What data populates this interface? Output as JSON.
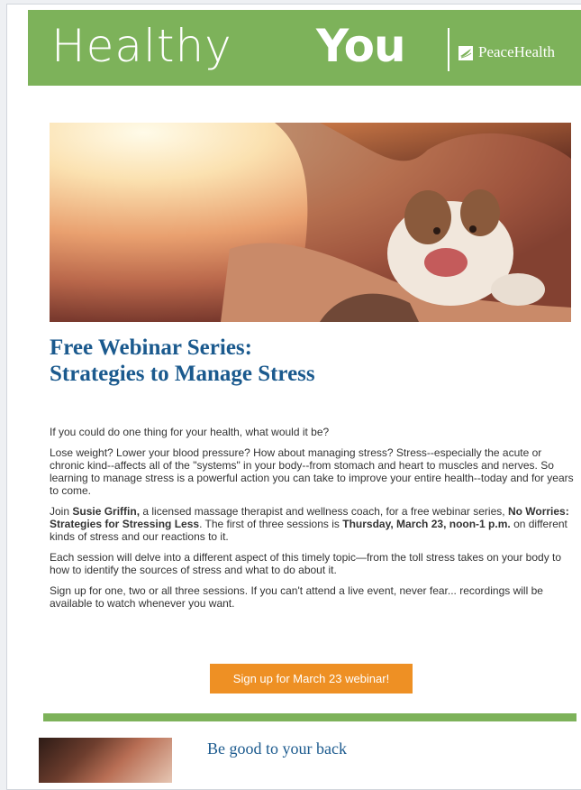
{
  "header": {
    "logo_healthy": "Healthy",
    "logo_you": "You",
    "brand_name": "PeaceHealth",
    "brand_color": "#7db25a"
  },
  "hero": {
    "image": "woman-hugging-puppy"
  },
  "article": {
    "title_line1": "Free Webinar Series:",
    "title_line2": "Strategies to Manage Stress",
    "p1": "If you could do one thing for your health, what would it be?",
    "p2": "Lose weight? Lower your blood pressure? How about managing stress? Stress--especially the acute or chronic kind--affects all of the \"systems\" in your body--from stomach and heart to muscles and nerves. So learning to manage stress is a powerful action you can take to improve your entire health--today and for years to come.",
    "p3_a": "Join ",
    "p3_name": "Susie Griffin,",
    "p3_b": " a licensed massage therapist and wellness coach, for a free webinar series, ",
    "p3_series": "No Worries:  Strategies for Stressing Less",
    "p3_c": ". The first of three sessions is ",
    "p3_date": "Thursday, March 23, noon-1 p.m.",
    "p3_d": " on different kinds of stress and our reactions to it.",
    "p4": "Each session will delve into a different aspect of this timely topic—from the toll stress takes on your body to how to identify the sources of stress and what to do about it.",
    "p5": "Sign up for one, two or all three sessions. If you can't attend a live event, never fear... recordings will be available to watch whenever you want.",
    "cta_label": "Sign up for March 23 webinar!",
    "cta_color": "#ee9024"
  },
  "next_article": {
    "thumb_caption": "",
    "title": "Be good to your back"
  }
}
